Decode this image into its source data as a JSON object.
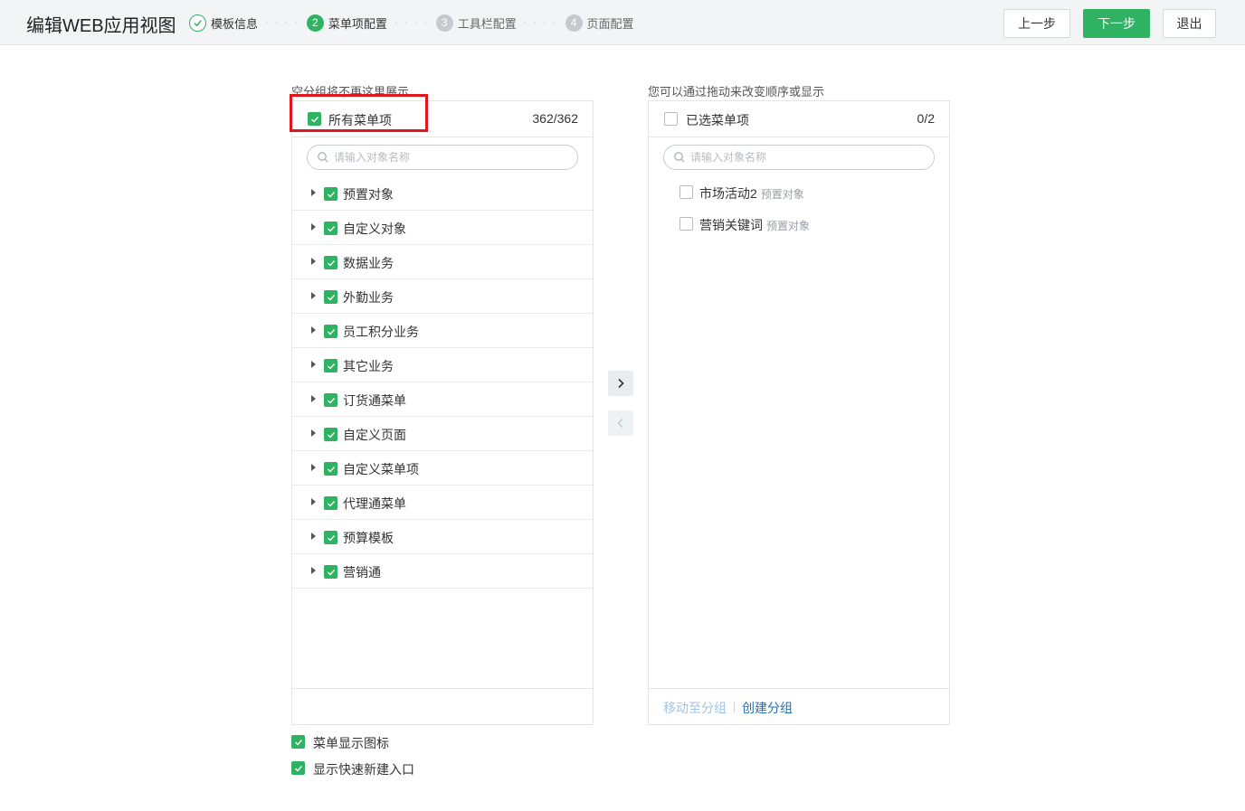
{
  "header": {
    "title": "编辑WEB应用视图",
    "steps": [
      {
        "number": "",
        "label": "模板信息",
        "status": "done"
      },
      {
        "number": "2",
        "label": "菜单项配置",
        "status": "active"
      },
      {
        "number": "3",
        "label": "工具栏配置",
        "status": "todo"
      },
      {
        "number": "4",
        "label": "页面配置",
        "status": "todo"
      }
    ],
    "step_separator": "· · · ·",
    "buttons": {
      "prev": "上一步",
      "next": "下一步",
      "exit": "退出"
    }
  },
  "left_panel": {
    "caption": "空分组将不再这里展示",
    "header_label": "所有菜单项",
    "count": "362/362",
    "search_placeholder": "请输入对象名称",
    "items": [
      {
        "label": "预置对象",
        "checked": true
      },
      {
        "label": "自定义对象",
        "checked": true
      },
      {
        "label": "数据业务",
        "checked": true
      },
      {
        "label": "外勤业务",
        "checked": true
      },
      {
        "label": "员工积分业务",
        "checked": true
      },
      {
        "label": "其它业务",
        "checked": true
      },
      {
        "label": "订货通菜单",
        "checked": true
      },
      {
        "label": "自定义页面",
        "checked": true
      },
      {
        "label": "自定义菜单项",
        "checked": true
      },
      {
        "label": "代理通菜单",
        "checked": true
      },
      {
        "label": "预算模板",
        "checked": true
      },
      {
        "label": "营销通",
        "checked": true
      }
    ]
  },
  "right_panel": {
    "caption": "您可以通过拖动来改变顺序或显示",
    "header_label": "已选菜单项",
    "count": "0/2",
    "search_placeholder": "请输入对象名称",
    "items": [
      {
        "name": "市场活动2",
        "type": "预置对象"
      },
      {
        "name": "营销关键词",
        "type": "预置对象"
      }
    ],
    "footer": {
      "move_to_group": "移动至分组",
      "separator": "|",
      "create_group": "创建分组"
    }
  },
  "options": [
    {
      "label": "菜单显示图标",
      "checked": true
    },
    {
      "label": "显示快速新建入口",
      "checked": true
    }
  ],
  "colors": {
    "accent": "#30b263",
    "highlight": "#e0161c",
    "link": "#1f6fbf",
    "link_disabled": "#9fc3e6"
  }
}
